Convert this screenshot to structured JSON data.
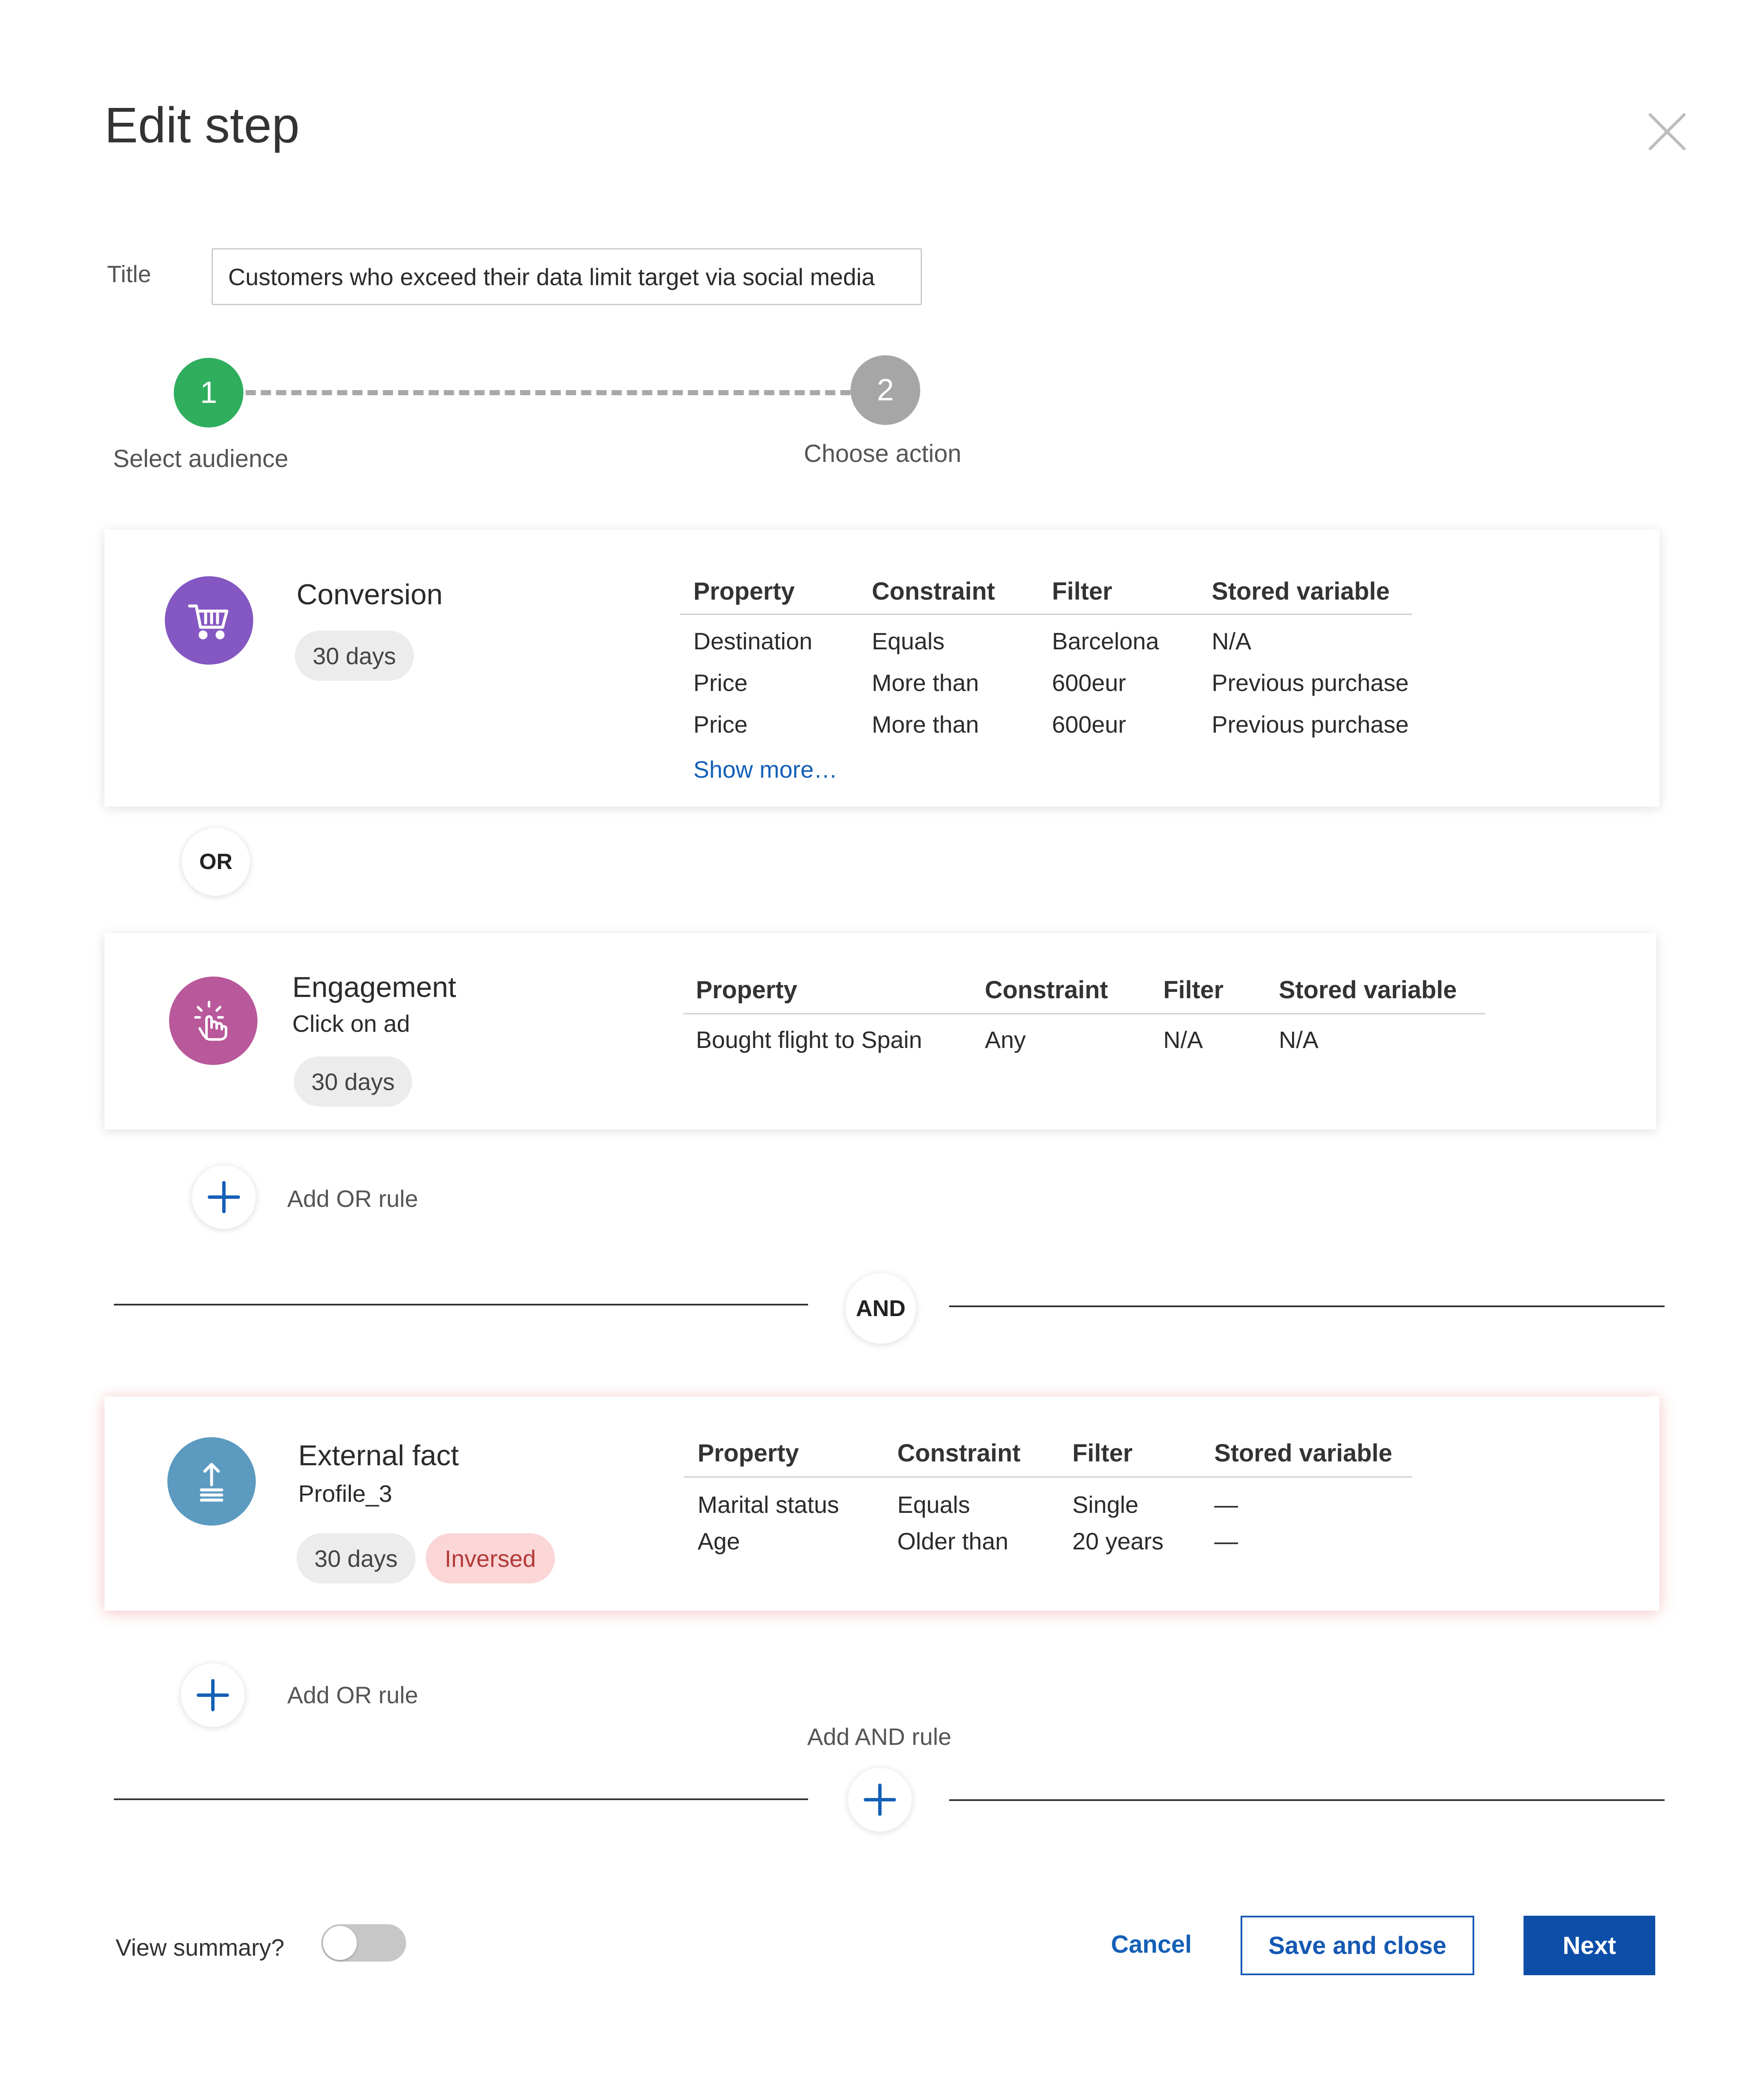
{
  "modal": {
    "title": "Edit step"
  },
  "title_field": {
    "label": "Title",
    "value": "Customers who exceed their data limit target via social media"
  },
  "stepper": {
    "steps": [
      {
        "number": "1",
        "label": "Select audience",
        "state": "active",
        "color": "#2fae5e"
      },
      {
        "number": "2",
        "label": "Choose action",
        "state": "inactive",
        "color": "#a6a6a6"
      }
    ]
  },
  "columns": {
    "property": "Property",
    "constraint": "Constraint",
    "filter": "Filter",
    "stored_variable": "Stored variable"
  },
  "rules": [
    {
      "icon": "shopping-cart-icon",
      "icon_color": "#8457c2",
      "name": "Conversion",
      "days": "30 days",
      "rows": [
        [
          "Destination",
          "Equals",
          "Barcelona",
          "N/A"
        ],
        [
          "Price",
          "More than",
          "600eur",
          "Previous purchase"
        ],
        [
          "Price",
          "More than",
          "600eur",
          "Previous purchase"
        ]
      ],
      "show_more": "Show more…"
    },
    {
      "icon": "tap-hand-icon",
      "icon_color": "#b9589b",
      "name": "Engagement",
      "subtitle": "Click on ad",
      "days": "30 days",
      "rows": [
        [
          "Bought flight to Spain",
          "Any",
          "N/A",
          "N/A"
        ]
      ]
    },
    {
      "icon": "upload-icon",
      "icon_color": "#5c9ac0",
      "name": "External fact",
      "subtitle": "Profile_3",
      "days": "30 days",
      "badge": "Inversed",
      "rows": [
        [
          "Marital status",
          "Equals",
          "Single",
          "—"
        ],
        [
          "Age",
          "Older than",
          "20 years",
          "—"
        ]
      ]
    }
  ],
  "connectors": {
    "or": "OR",
    "and": "AND"
  },
  "actions": {
    "add_or_rule": "Add OR rule",
    "add_and_rule": "Add AND rule"
  },
  "footer": {
    "view_summary_label": "View summary?",
    "view_summary_on": false,
    "cancel": "Cancel",
    "save_close": "Save and close",
    "next": "Next"
  },
  "colors": {
    "primary": "#0d4fa8",
    "link": "#1460b7",
    "danger_bg": "#fbd6d6",
    "danger_text": "#b33a3a"
  }
}
